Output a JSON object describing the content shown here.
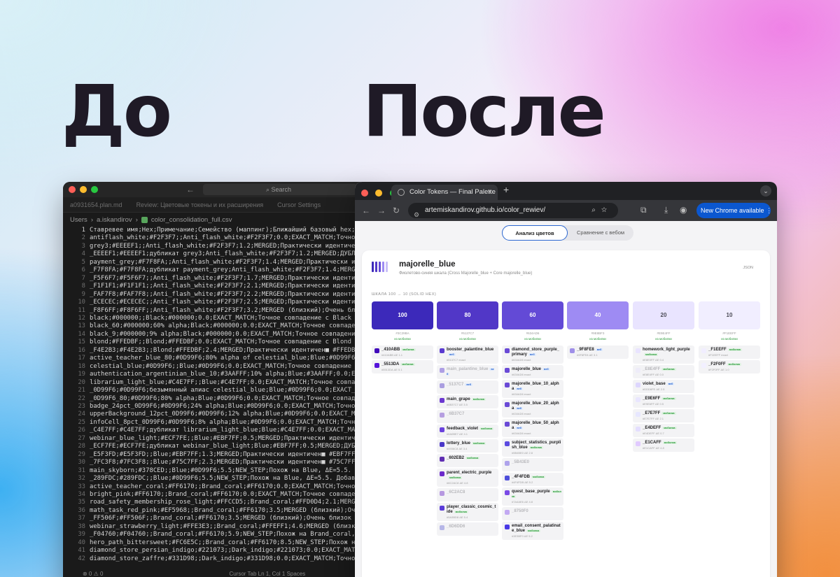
{
  "headings": {
    "before": "До",
    "after": "После"
  },
  "editor": {
    "search_label": "Search",
    "tabs": [
      "a0931654.plan.md",
      "Review: Цветовые токены и их расширения",
      "Cursor Settings"
    ],
    "path": [
      "Users",
      "a.iskandirov",
      "color_consolidation_full.csv"
    ],
    "lines": [
      "Ставревее имя;Hex;Примечание;Семейство (маппинг);Ближайший базовый hex;Delta E;Ст",
      "antiflash_white;#F2F3F7;;Anti_flash_white;#F2F3F7;0.0;EXACT_MATCH;Точное совпаде",
      "grey3;#EEEEF1;;Anti_flash_white;#F2F3F7;1.2;MERGED;Практически идентичен■ #F2F3F",
      "_EEEEF1;#EEEEF1;дубликат grey3;Anti_flash_white;#F2F3F7;1.2;MERGED;ДУБЛИКАТ. Практ",
      "payment_grey;#F7F8FA;;Anti_flash_white;#F2F3F7;1.4;MERGED;Практически идентичен■",
      "_F7F8FA;#F7F8FA;дубликат payment_grey;Anti_flash_white;#F2F3F7;1.4;MERGED;ДУБЛИКА",
      "_F5F6F7;#F5F6F7;;Anti_flash_white;#F2F3F7;1.7;MERGED;Практически идентичен■ #F2F",
      "_F1F1F1;#F1F1F1;;Anti_flash_white;#F2F3F7;2.1;MERGED;Практически идентичен■ #F2F",
      "_FAF7F8;#FAF7F8;;Anti_flash_white;#F2F3F7;2.2;MERGED;Практически идентичен■ #F2F",
      "_ECECEC;#ECECEC;;Anti_flash_white;#F2F3F7;2.5;MERGED;Практически идентичен■ #F2F",
      "_F8F6FF;#F8F6FF;;Anti_flash_white;#F2F3F7;3.2;MERGED (близкий);Очень близок к■ #",
      "black;#000000;;Black;#000000;0.0;EXACT_MATCH;Точное совпадение с Black",
      "black_60;#000000;60% alpha;Black;#000000;0.0;EXACT_MATCH;Точное совпадение с Blac",
      "black_9;#000000;9% alpha;Black;#000000;0.0;EXACT_MATCH;Точное совпадение с Black",
      "blond;#FFEDBF;;Blond;#FFEDBF;0.0;EXACT_MATCH;Точное совпадение с Blond",
      "_F4E2B3;#F4E2B3;;Blond;#FFEDBF;2.4;MERGED;Практически идентичен■ #FFEDBF в Blond",
      "active_teacher_blue_80;#0D99F6;80% alpha of celestial_blue;Blue;#0D99F6;0.0;EXACT",
      "celestial_blue;#0D99F6;;Blue;#0D99F6;0.0;EXACT_MATCH;Точное совпадение с Blue",
      "authentication_argentinian_blue_10;#3AAFFF;10% alpha;Blue;#3AAFFF;0.0;EXACT_MATCH",
      "librarium_light_blue;#C4E7FF;;Blue;#C4E7FF;0.0;EXACT_MATCH;Точное совпадение с Bl",
      "_0D99F6;#0D99F6;безымянный алиас celestial_blue;Blue;#0D99F6;0.0;EXACT_MATCH;ДУБЛ",
      "_0D99F6_80;#0D99F6;80% alpha;Blue;#0D99F6;0.0;EXACT_MATCH;Точное совпадение с Blu",
      "badge_24pct_0D99F6;#0D99F6;24% alpha;Blue;#0D99F6;0.0;EXACT_MATCH;Точное совпадени",
      "upperBackground_12pct_0D99F6;#0D99F6;12% alpha;Blue;#0D99F6;0.0;EXACT_MATCH;Точно",
      "infoCell_8pct_0D99F6;#0D99F6;8% alpha;Blue;#0D99F6;0.0;EXACT_MATCH;Точное совпаде",
      "_C4E7FF;#C4E7FF;дубликат librarium_light_blue;Blue;#C4E7FF;0.0;EXACT_MATCH;Точно",
      "webinar_blue_light;#ECF7FE;;Blue;#EBF7FF;0.5;MERGED;Практически идентичен■ #EBF7",
      "_ECF7FE;#ECF7FE;дубликат webinar_blue_light;Blue;#EBF7FF;0.5;MERGED;ДУБЛИКАТ. Пра",
      "_E5F3FD;#E5F3FD;;Blue;#EBF7FF;1.3;MERGED;Практически идентичен■ #EBF7FF в Blue.",
      "_7FC3F8;#7FC3F8;;Blue;#75C7FF;2.3;MERGED;Практически идентичен■ #75C7FF в Blue.",
      "main_skyborn;#378CED;;Blue;#0D99F6;5.5;NEW_STEP;Похож на Blue, ΔE=5.5. Добавить к",
      "_289FDC;#289FDC;;Blue;#0D99F6;5.5;NEW_STEP;Похож на Blue, ΔE=5.5. Добавить как но",
      "active_teacher_coral;#FF6170;;Brand_coral;#FF6170;0.0;EXACT_MATCH;Точное совпадени",
      "bright_pink;#FF6170;;Brand_coral;#FF6170;0.0;EXACT_MATCH;Точное совпадение с Bran",
      "road_safety_membership_rose_light;#FFCCD5;;Brand_coral;#FFD0D4;2.1;MERGED;Практич",
      "math_task_red_pink;#EF5968;;Brand_coral;#FF6170;3.5;MERGED (близкий);Очень близок",
      "_FF506F;#FF506F;;Brand_coral;#FF6170;3.5;MERGED (близкий);Очень близок к■ #FF6170",
      "webinar_strawberry_light;#FFE3E3;;Brand_coral;#FFEFF1;4.6;MERGED (близкий);Очень",
      "_F04760;#F04760;;Brand_coral;#FF6170;5.9;NEW_STEP;Похож на Brand_coral, ΔE=5.9. Д",
      "hero_path_bittersweet;#FC6E5C;;Brand_coral;#FF6170;8.5;NEW_STEP;Похож на Brand_co",
      "diamond_store_persian_indigo;#221073;;Dark_indigo;#221073;0.0;EXACT_MATCH;Точное",
      "diamond_store_zaffre;#331D98;;Dark_indigo;#331D98;0.0;EXACT_MATCH;Точное совпаден"
    ],
    "status": [
      "⊗ 0 ⚠ 0",
      "Cursor Tab   Ln 1, Col 1   Spaces"
    ]
  },
  "browser": {
    "tab_title": "Color Tokens — Final Palette",
    "url": "artemiskandirov.github.io/color_rewiev/",
    "new_chrome": "New Chrome available",
    "segments": [
      "Анализ цветов",
      "Сравнение с вебом"
    ],
    "family": {
      "name": "majorelle_blue",
      "subtitle": "Фиолетово-синяя шкала (Cross Majorelle_blue + Core majorelle_blue)",
      "json_label": "JSON",
      "scale_label": "ШКАЛА 100 → 10 (SOLID HEX)"
    },
    "steps": [
      {
        "label": "100",
        "hex": "#3C29BA",
        "color": "#3c29ba",
        "text": "#ffffff",
        "source": "из мобилки",
        "tokens": [
          {
            "name": "_410ABB",
            "color": "#410abb",
            "badge": "мобилка",
            "meta": "#410ABB ΔE 1.1"
          },
          {
            "name": "_5513DA",
            "color": "#5513da",
            "badge": "мобилка",
            "meta": "#5513DA ΔE 5.1"
          }
        ]
      },
      {
        "label": "80",
        "hex": "#5137C7",
        "color": "#5137c7",
        "text": "#ffffff",
        "source": "из мобилки",
        "tokens": [
          {
            "name": "booster_palantine_blue",
            "color": "#5a3ad0",
            "badge": "веб",
            "meta": "#5137C7 exact"
          },
          {
            "name": "main_palantine_blue",
            "color": "#5a3ad0",
            "badge": "веб",
            "meta": "",
            "dim": true
          },
          {
            "name": "_5137C7",
            "color": "#5137c7",
            "badge": "веб",
            "meta": "",
            "dim": true
          },
          {
            "name": "main_grape",
            "color": "#6b37d0",
            "badge": "мобилка",
            "meta": "#6B37C7 ΔE 3.5"
          },
          {
            "name": "_6B37C7",
            "color": "#6b37c7",
            "badge": "",
            "meta": "",
            "dim": true
          },
          {
            "name": "feedback_violet",
            "color": "#6a42dd",
            "badge": "мобилка",
            "meta": "#6A0BE7 ΔE 4.1"
          },
          {
            "name": "lottery_blue",
            "color": "#4936c8",
            "badge": "мобилка",
            "meta": "#4936C8 ΔE 3.4"
          },
          {
            "name": "_602EB2",
            "color": "#602eb2",
            "badge": "мобилка",
            "meta": ""
          },
          {
            "name": "parent_electric_purple",
            "color": "#6c2acb",
            "badge": "мобилка",
            "meta": "#6C2AC8 ΔE 4.8"
          },
          {
            "name": "_6C2AC8",
            "color": "#6c2ac8",
            "badge": "",
            "meta": "",
            "dim": true
          },
          {
            "name": "player_classic_cosmic_tide",
            "color": "#5a3bd8",
            "badge": "мобилка",
            "meta": "#5A3BD8 ΔE 5.4"
          },
          {
            "name": "_6D6DD6",
            "color": "#6d6dd6",
            "badge": "",
            "meta": "",
            "dim": true
          }
        ]
      },
      {
        "label": "60",
        "hex": "#634AD6",
        "color": "#634ad6",
        "text": "#ffffff",
        "source": "из мобилки",
        "tokens": [
          {
            "name": "diamond_store_purple_primary",
            "color": "#6a4ad6",
            "badge": "веб",
            "meta": "#634AD6 exact"
          },
          {
            "name": "majorelle_blue",
            "color": "#6a4ad6",
            "badge": "веб",
            "meta": "#634AD6 exact"
          },
          {
            "name": "majorelle_blue_10_alpha",
            "color": "#6a4ad6",
            "badge": "веб",
            "meta": "#634AD6 exact"
          },
          {
            "name": "majorelle_blue_20_alpha",
            "color": "#6a4ad6",
            "badge": "веб",
            "meta": "#634AD6 exact"
          },
          {
            "name": "majorelle_blue_50_alpha",
            "color": "#6a4ad6",
            "badge": "веб",
            "meta": "#634AD6 exact"
          },
          {
            "name": "subject_statistics_purplish_blue",
            "color": "#5b4be0",
            "badge": "мобилка",
            "meta": "#5B4BE0 ΔE 2.8"
          },
          {
            "name": "_5B43E0",
            "color": "#5b43e0",
            "badge": "",
            "meta": "",
            "dim": true
          },
          {
            "name": "_4F4FDB",
            "color": "#4f4fdb",
            "badge": "мобилка",
            "meta": "#4F4FDB ΔE 5.2"
          },
          {
            "name": "quest_base_purple",
            "color": "#7a4ae6",
            "badge": "мобилка",
            "meta": "#7A4AE6 ΔE 4.8"
          },
          {
            "name": "_8750F0",
            "color": "#8750f0",
            "badge": "",
            "meta": "",
            "dim": true
          },
          {
            "name": "email_consent_palatinate_blue",
            "color": "#4a3ae6",
            "badge": "мобилка",
            "meta": "#3E3BF0 ΔE 5.2"
          }
        ]
      },
      {
        "label": "40",
        "hex": "#9E8BF3",
        "color": "#9e8bf3",
        "text": "#ffffff",
        "source": "из мобилки",
        "tokens": [
          {
            "name": "_9F8FE8",
            "color": "#9f8fe8",
            "badge": "веб",
            "meta": "#9F8FE8 ΔE 3.1"
          }
        ]
      },
      {
        "label": "20",
        "hex": "#E9E4FF",
        "color": "#e9e4ff",
        "text": "#4a4a55",
        "source": "из мобилки",
        "tokens": [
          {
            "name": "homework_light_purple",
            "color": "#e9e4ff",
            "badge": "мобилка",
            "meta": "#E8E0FF ΔE 0.4"
          },
          {
            "name": "_E8E4FF",
            "color": "#e8e4ff",
            "badge": "мобилка",
            "meta": "#E8E4FF ΔE 0.0",
            "dim": true
          },
          {
            "name": "violet_base",
            "color": "#ddd6fe",
            "badge": "веб",
            "meta": "#DDD6FE ΔE 2.5"
          },
          {
            "name": "_E9E6FF",
            "color": "#e9e6ff",
            "badge": "мобилка",
            "meta": "#E9E6FF ΔE 0.5"
          },
          {
            "name": "_E7E7FF",
            "color": "#e7e7ff",
            "badge": "мобилка",
            "meta": "#E7E7FF ΔE 2.1"
          },
          {
            "name": "_E4DEFF",
            "color": "#e4deff",
            "badge": "мобилка",
            "meta": "#E4DEFF ΔE 0.7"
          },
          {
            "name": "_E1CAFF",
            "color": "#e1caff",
            "badge": "мобилка",
            "meta": "#E1CAFF ΔE 4.8"
          }
        ]
      },
      {
        "label": "10",
        "hex": "#F1EEFF",
        "color": "#f1eeff",
        "text": "#4a4a55",
        "source": "из мобилки",
        "tokens": [
          {
            "name": "_F1EEFF",
            "color": "#f1eeff",
            "badge": "мобилка",
            "meta": "#F1EEFF exact"
          },
          {
            "name": "_F2F0FF",
            "color": "#f2f0ff",
            "badge": "мобилка",
            "meta": "#F2F0FF ΔE 1.0"
          }
        ]
      }
    ]
  }
}
